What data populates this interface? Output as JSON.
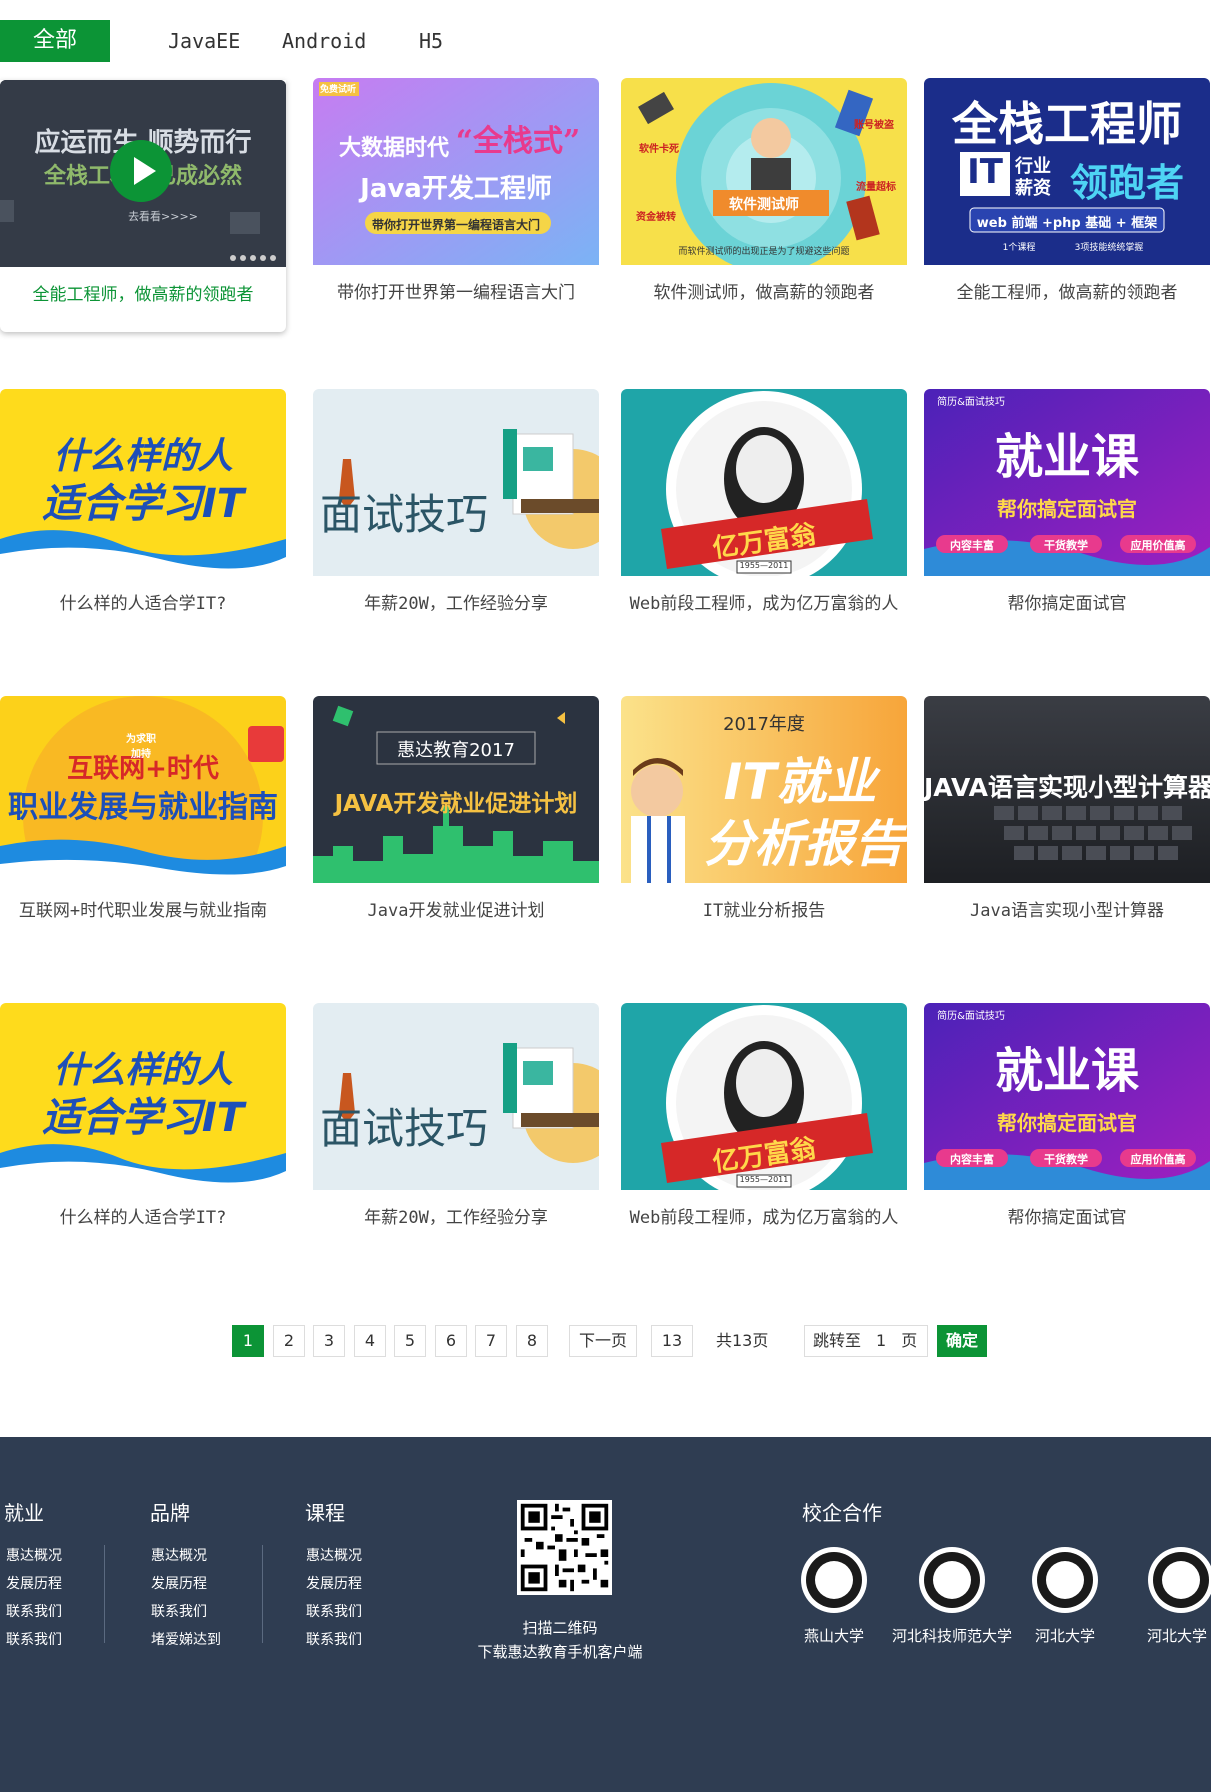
{
  "tabs": [
    {
      "label": "全部",
      "active": true
    },
    {
      "label": "JavaEE",
      "active": false
    },
    {
      "label": "Android",
      "active": false
    },
    {
      "label": "H5",
      "active": false
    }
  ],
  "courses": [
    {
      "title": "全能工程师，做高薪的领跑者",
      "thumb_text": [
        "应运而生 顺势而行",
        "全栈工程师已成必然",
        "去看看>>>>"
      ],
      "accent": "#2f3640"
    },
    {
      "title": "带你打开世界第一编程语言大门",
      "thumb_text": [
        "免费试听",
        "大数据时代",
        "“全栈式”",
        "Java开发工程师",
        "带你打开世界第一编程语言大门"
      ],
      "accent": "#b07cf0"
    },
    {
      "title": "软件测试师，做高薪的领跑者",
      "thumb_text": [
        "软件测试师",
        "软件卡死",
        "账号被盗",
        "流量超标",
        "资金被转",
        "而软件测试师的出现正是为了规避这些问题"
      ],
      "accent": "#6bd3d6"
    },
    {
      "title": "全能工程师，做高薪的领跑者",
      "thumb_text": [
        "全栈工程师",
        "IT",
        "行业",
        "薪资",
        "领跑者",
        "web 前端 +php 基础 + 框架",
        "1个课程",
        "3项技能统统掌握"
      ],
      "accent": "#1b2d8a"
    },
    {
      "title": "什么样的人适合学IT?",
      "thumb_text": [
        "什么样的人",
        "适合学习IT"
      ],
      "accent": "#fedb1c"
    },
    {
      "title": "年薪20W，工作经验分享",
      "thumb_text": [
        "面试技巧"
      ],
      "accent": "#e3edf2"
    },
    {
      "title": "Web前段工程师，成为亿万富翁的人",
      "thumb_text": [
        "亿万富翁",
        "1955—2011"
      ],
      "accent": "#1fa5a8"
    },
    {
      "title": "帮你搞定面试官",
      "thumb_text": [
        "简历&面试技巧",
        "就业课",
        "帮你搞定面试官",
        "内容丰富",
        "干货教学",
        "应用价值高"
      ],
      "accent": "#6b1fc7"
    },
    {
      "title": "互联网+时代职业发展与就业指南",
      "thumb_text": [
        "互联网+时代",
        "职业发展与就业指南",
        "为求职加持"
      ],
      "accent": "#fcd11a"
    },
    {
      "title": "Java开发就业促进计划",
      "thumb_text": [
        "惠达教育2017",
        "JAVA开发就业促进计划"
      ],
      "accent": "#2b3340"
    },
    {
      "title": "IT就业分析报告",
      "thumb_text": [
        "2017年度",
        "IT就业",
        "分析报告"
      ],
      "accent": "#f7c34a"
    },
    {
      "title": "Java语言实现小型计算器",
      "thumb_text": [
        "JAVA语言实现小型计算器"
      ],
      "accent": "#2c2e33"
    },
    {
      "title": "什么样的人适合学IT?",
      "thumb_text": [
        "什么样的人",
        "适合学习IT"
      ],
      "accent": "#fedb1c"
    },
    {
      "title": "年薪20W，工作经验分享",
      "thumb_text": [
        "面试技巧"
      ],
      "accent": "#e3edf2"
    },
    {
      "title": "Web前段工程师，成为亿万富翁的人",
      "thumb_text": [
        "亿万富翁",
        "1955—2011"
      ],
      "accent": "#1fa5a8"
    },
    {
      "title": "帮你搞定面试官",
      "thumb_text": [
        "简历&面试技巧",
        "就业课",
        "帮你搞定面试官",
        "内容丰富",
        "干货教学",
        "应用价值高"
      ],
      "accent": "#6b1fc7"
    }
  ],
  "pager": {
    "pages": [
      "1",
      "2",
      "3",
      "4",
      "5",
      "6",
      "7",
      "8"
    ],
    "current": "1",
    "next_label": "下一页",
    "last_page": "13",
    "total_label": "共13页",
    "jump_prefix": "跳转至",
    "jump_value": "1",
    "jump_suffix": "页",
    "confirm_label": "确定"
  },
  "footer": {
    "columns": [
      {
        "title": "就业",
        "links": [
          "惠达概况",
          "发展历程",
          "联系我们",
          "联系我们"
        ]
      },
      {
        "title": "品牌",
        "links": [
          "惠达概况",
          "发展历程",
          "联系我们",
          "堵爱娣达到"
        ]
      },
      {
        "title": "课程",
        "links": [
          "惠达概况",
          "发展历程",
          "联系我们",
          "联系我们"
        ]
      }
    ],
    "qr_caption": [
      "扫描二维码",
      "下载惠达教育手机客户端"
    ],
    "partners_title": "校企合作",
    "partners": [
      "燕山大学",
      "河北科技师范大学",
      "河北大学",
      "河北大学"
    ],
    "bg_color": "#2f3d52"
  },
  "colors": {
    "brand_green": "#0c9436"
  }
}
